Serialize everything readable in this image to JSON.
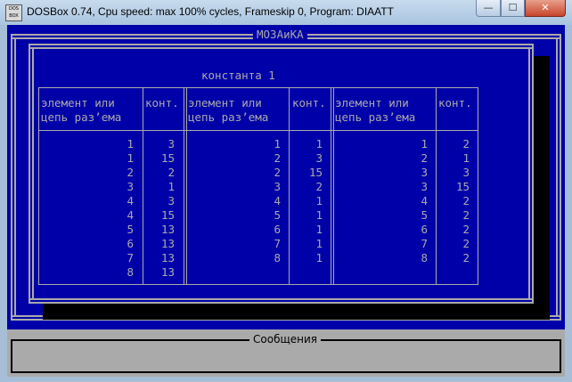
{
  "window": {
    "icon_text": "DOS BOX",
    "title": "DOSBox 0.74, Cpu speed: max 100% cycles, Frameskip  0, Program:   DIAATT",
    "minimize": "—",
    "maximize": "☐",
    "close": "✕"
  },
  "panel": {
    "title": "МОЗАиКА",
    "subtitle": "константа 1"
  },
  "table": {
    "groups": [
      {
        "header_element_1": "элемент или",
        "header_element_2": "цепь раз’ема",
        "header_contact": "конт.",
        "rows": [
          [
            "1",
            "3"
          ],
          [
            "1",
            "15"
          ],
          [
            "2",
            "2"
          ],
          [
            "3",
            "1"
          ],
          [
            "4",
            "3"
          ],
          [
            "4",
            "15"
          ],
          [
            "5",
            "13"
          ],
          [
            "6",
            "13"
          ],
          [
            "7",
            "13"
          ],
          [
            "8",
            "13"
          ]
        ]
      },
      {
        "header_element_1": "элемент или",
        "header_element_2": "цепь раз’ема",
        "header_contact": "конт.",
        "rows": [
          [
            "1",
            "1"
          ],
          [
            "2",
            "3"
          ],
          [
            "2",
            "15"
          ],
          [
            "3",
            "2"
          ],
          [
            "4",
            "1"
          ],
          [
            "5",
            "1"
          ],
          [
            "6",
            "1"
          ],
          [
            "7",
            "1"
          ],
          [
            "8",
            "1"
          ]
        ]
      },
      {
        "header_element_1": "элемент или",
        "header_element_2": "цепь раз’ема",
        "header_contact": "конт.",
        "rows": [
          [
            "1",
            "2"
          ],
          [
            "2",
            "1"
          ],
          [
            "3",
            "3"
          ],
          [
            "3",
            "15"
          ],
          [
            "4",
            "2"
          ],
          [
            "5",
            "2"
          ],
          [
            "6",
            "2"
          ],
          [
            "7",
            "2"
          ],
          [
            "8",
            "2"
          ]
        ]
      }
    ]
  },
  "messages": {
    "title": "Сообщения"
  },
  "colors": {
    "dos_blue": "#0000a8",
    "dos_gray": "#aaaaaa"
  }
}
